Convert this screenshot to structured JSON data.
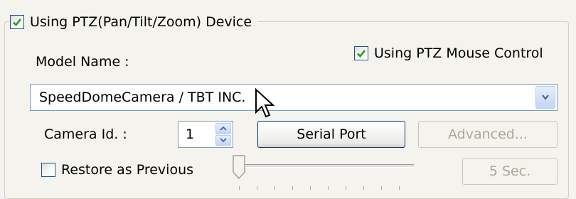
{
  "ptz_device": {
    "checked": true,
    "label": "Using PTZ(Pan/Tilt/Zoom) Device"
  },
  "model_name_label": "Model Name :",
  "mouse_control": {
    "checked": true,
    "label": "Using PTZ Mouse Control"
  },
  "model_select": {
    "value": "SpeedDomeCamera / TBT INC."
  },
  "camera_id": {
    "label": "Camera Id. :",
    "value": "1"
  },
  "buttons": {
    "serial_port": "Serial Port",
    "advanced": "Advanced...",
    "seconds": "5 Sec."
  },
  "restore": {
    "checked": false,
    "label": "Restore as Previous"
  },
  "slider": {
    "position": 0
  },
  "colors": {
    "check_mark": "#21a121",
    "border_blue": "#7f9db9",
    "window_bg": "#f4f3ee"
  }
}
